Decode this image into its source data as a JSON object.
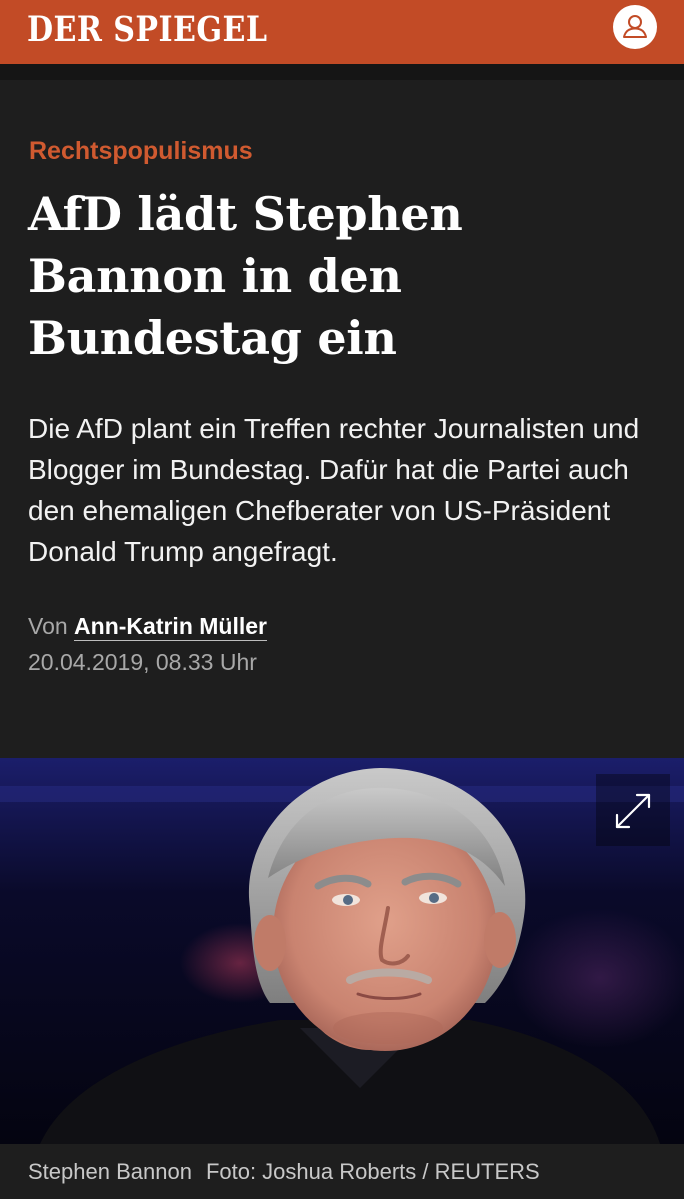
{
  "header": {
    "brand": "DER SPIEGEL",
    "brand_color": "#c24b26",
    "account_icon": "user-icon"
  },
  "article": {
    "kicker": "Rechtspopulismus",
    "headline": "AfD lädt Stephen Bannon in den Bundestag ein",
    "teaser": "Die AfD plant ein Treffen rechter Journalisten und Blogger im Bundestag. Dafür hat die Partei auch den ehemaligen Chefberater von US-Präsident Donald Trump angefragt.",
    "byline_prefix": "Von",
    "author": "Ann-Katrin Müller",
    "date": "20.04.2019, 08.33 Uhr"
  },
  "photo": {
    "caption": "Stephen Bannon",
    "credit": "Foto: Joshua Roberts / REUTERS",
    "expand_icon": "expand-icon"
  },
  "colors": {
    "kicker": "#d05a30",
    "background": "#1e1e1e"
  }
}
